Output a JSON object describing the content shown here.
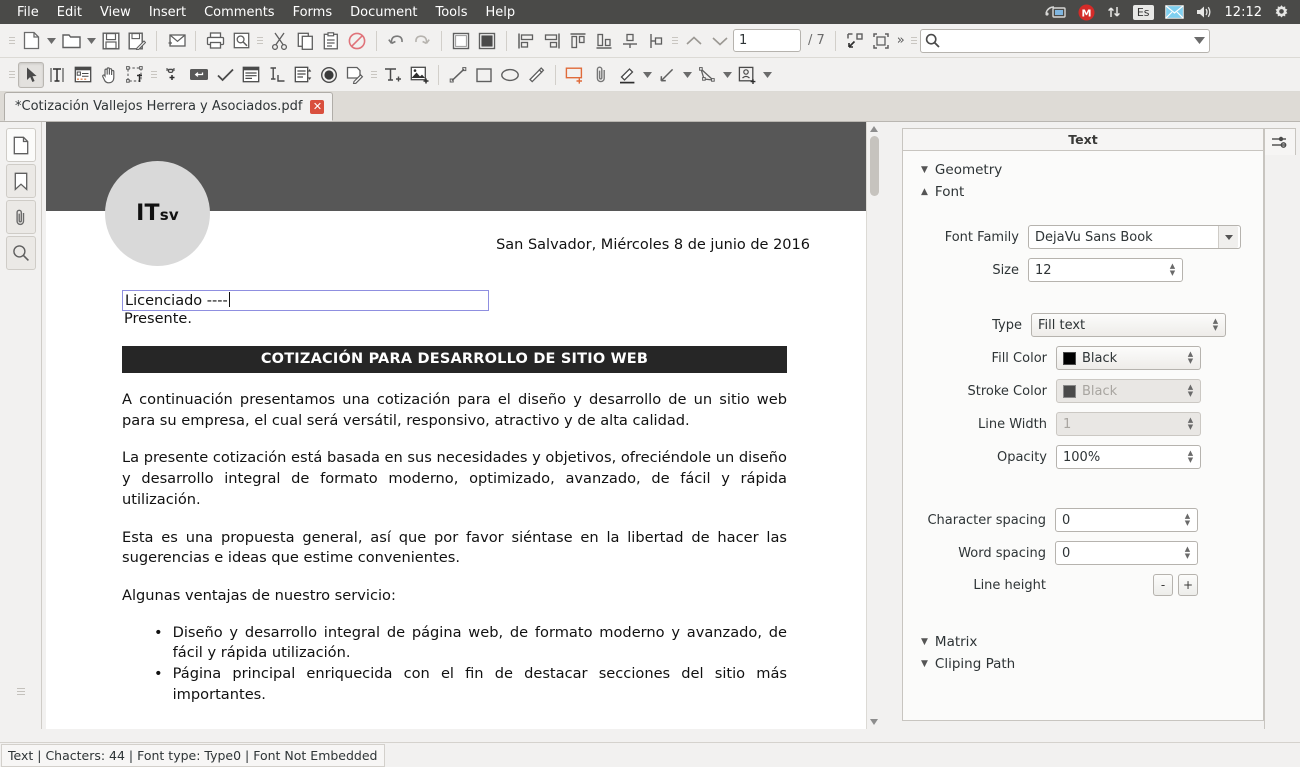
{
  "menubar": {
    "items": [
      "File",
      "Edit",
      "View",
      "Insert",
      "Comments",
      "Forms",
      "Document",
      "Tools",
      "Help"
    ],
    "tray": {
      "remote_icon": "remote-desktop-icon",
      "mail_badge_letter": "M",
      "network_icon": "network-updown-icon",
      "keyboard_layout": "Es",
      "envelope_icon": "envelope-icon",
      "volume_icon": "volume-icon",
      "clock": "12:12",
      "gear_icon": "gear-icon"
    },
    "colors": {
      "bar_bg": "#4a4a48",
      "text": "#ffffff",
      "badge_red": "#d42b28"
    }
  },
  "toolbar1": {
    "new_doc": "new-document-button",
    "new_doc_arrow": "new-document-dropdown",
    "open": "open-folder-button",
    "open_arrow": "open-folder-dropdown",
    "save": "save-button",
    "save_as": "save-as-button",
    "mail": "send-mail-button",
    "print": "print-button",
    "print_preview": "print-preview-button",
    "cut": "cut-button",
    "copy": "copy-button",
    "paste": "paste-button",
    "forbidden": "delete-forbidden-button",
    "undo": "undo-button",
    "redo": "redo-button",
    "page_outline": "page-border-button",
    "page_fill": "page-fill-button",
    "align_left": "align-left-button",
    "align_right": "align-right-button",
    "align_top": "align-top-button",
    "align_bottom": "align-bottom-button",
    "align_center_v": "align-center-vertical-button",
    "align_center_h": "align-center-horizontal-button",
    "prev_page": "previous-page-button",
    "next_page": "next-page-button",
    "page_value": "1",
    "page_total": "/ 7",
    "fit_page": "fit-page-button",
    "fit_width": "fit-selection-button",
    "overflow": "»",
    "search_placeholder": "",
    "search_value": ""
  },
  "toolbar2": {
    "select": "select-tool",
    "text": "text-tool",
    "form": "form-tool",
    "hand": "hand-tool",
    "marquee": "marquee-select-tool",
    "link": "add-link-tool",
    "button": "push-button-tool",
    "checkbox": "checkbox-tool",
    "textfield": "text-field-tool",
    "linefield": "line-field-tool",
    "listbox": "list-box-tool",
    "radio": "radio-button-tool",
    "note_edit": "edit-note-tool",
    "add_text": "add-text-tool",
    "add_image": "add-image-tool",
    "line": "line-tool",
    "rectangle": "rectangle-tool",
    "ellipse": "ellipse-tool",
    "pencil": "pencil-tool",
    "sticky_note": "sticky-note-tool",
    "attach": "attach-file-tool",
    "highlight": "highlight-tool",
    "highlight_arrow": "highlight-dropdown",
    "arrow_line": "arrow-line-tool",
    "arrow_line_arrow": "arrow-line-dropdown",
    "polygon": "polygon-tool",
    "polygon_arrow": "polygon-dropdown",
    "stamp": "stamp-tool",
    "stamp_arrow": "stamp-dropdown"
  },
  "tabstrip": {
    "tab_label": "*Cotización Vallejos Herrera y Asociados.pdf",
    "close_glyph": "✕"
  },
  "rail": {
    "items": [
      {
        "name": "pages-panel-button",
        "icon": "page-icon",
        "active": true
      },
      {
        "name": "bookmarks-panel-button",
        "icon": "bookmark-icon",
        "active": false
      },
      {
        "name": "attachments-panel-button",
        "icon": "paperclip-icon",
        "active": false
      },
      {
        "name": "search-panel-button",
        "icon": "search-icon",
        "active": false
      }
    ]
  },
  "document": {
    "logo_main": "IT",
    "logo_sub": "sv",
    "date_line": "San Salvador, Miércoles 8 de junio de 2016",
    "selected_text": "Licenciado ----",
    "presente": "Presente.",
    "banner_title": "COTIZACIÓN PARA DESARROLLO DE SITIO WEB",
    "paragraphs": [
      "A continuación presentamos una cotización para el diseño y desarrollo de un sitio web para su empresa, el cual será versátil, responsivo, atractivo y de alta calidad.",
      "La presente cotización está basada en sus necesidades y objetivos, ofreciéndole un diseño y desarrollo integral de formato moderno, optimizado, avanzado, de fácil y rápida utilización.",
      "Esta es una propuesta general, así que por favor siéntase en la libertad de hacer las sugerencias e ideas que estime convenientes.",
      "Algunas ventajas de nuestro servicio:"
    ],
    "bullets": [
      "Diseño y desarrollo integral de página web, de formato moderno y avanzado, de fácil y rápida utilización.",
      "Página principal enriquecida con el fin de destacar secciones del sitio más importantes."
    ],
    "bullet_glyph": "•",
    "colors": {
      "header_band": "#575757",
      "banner_bg": "#262626",
      "logo_bg": "#d9d9d9",
      "selection_border": "#8f8fe0"
    }
  },
  "panel": {
    "title": "Text",
    "settings_icon": "sliders-icon",
    "sections": {
      "geometry": {
        "label": "Geometry",
        "expanded": false
      },
      "font": {
        "label": "Font",
        "expanded": true
      },
      "matrix": {
        "label": "Matrix",
        "expanded": false
      },
      "clipping": {
        "label": "Cliping Path",
        "expanded": false
      }
    },
    "fields": {
      "font_family": {
        "label": "Font Family",
        "value": "DejaVu Sans Book"
      },
      "size": {
        "label": "Size",
        "value": "12"
      },
      "type": {
        "label": "Type",
        "value": "Fill text"
      },
      "fill_color": {
        "label": "Fill Color",
        "value": "Black",
        "swatch": "#000000"
      },
      "stroke_color": {
        "label": "Stroke Color",
        "value": "Black",
        "swatch": "#4a4a4a",
        "disabled": true
      },
      "line_width": {
        "label": "Line Width",
        "value": "1",
        "disabled": true
      },
      "opacity": {
        "label": "Opacity",
        "value": "100%"
      },
      "character_spacing": {
        "label": "Character spacing",
        "value": "0"
      },
      "word_spacing": {
        "label": "Word spacing",
        "value": "0"
      },
      "line_height": {
        "label": "Line height",
        "minus": "-",
        "plus": "+"
      }
    }
  },
  "statusbar": {
    "text": "Text | Chacters: 44 | Font type: Type0 | Font Not Embedded"
  }
}
